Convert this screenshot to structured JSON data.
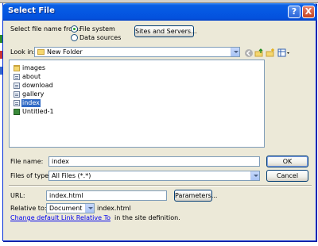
{
  "dialog": {
    "title": "Select File",
    "select_from_label": "Select file name from:",
    "source_options": [
      {
        "label": "File system",
        "selected": true
      },
      {
        "label": "Data sources",
        "selected": false
      }
    ],
    "sites_button": "Sites and Servers...",
    "look_in_label": "Look in:",
    "look_in_value": "New Folder",
    "files": [
      {
        "name": "images",
        "icon": "folder-icon",
        "selected": false
      },
      {
        "name": "about",
        "icon": "html-file-icon",
        "selected": false
      },
      {
        "name": "download",
        "icon": "html-file-icon",
        "selected": false
      },
      {
        "name": "gallery",
        "icon": "html-file-icon",
        "selected": false
      },
      {
        "name": "index",
        "icon": "html-file-icon",
        "selected": true
      },
      {
        "name": "Untitled-1",
        "icon": "dreamweaver-file-icon",
        "selected": false
      }
    ],
    "file_name_label": "File name:",
    "file_name_value": "index",
    "files_of_type_label": "Files of type:",
    "files_of_type_value": "All Files (*.*)",
    "ok_button": "OK",
    "cancel_button": "Cancel",
    "url_label": "URL:",
    "url_value": "index.html",
    "parameters_button": "Parameters...",
    "relative_to_label": "Relative to:",
    "relative_to_value": "Document",
    "relative_to_file": "index.html",
    "change_link_text": "Change default Link Relative To",
    "change_link_suffix": "in the site definition.",
    "help_button": "?",
    "close_button": "X"
  },
  "colors": {
    "titlebar": "#0558e2",
    "dialog_bg": "#ece9d8",
    "selection": "#316ac5",
    "link": "#0000ee"
  }
}
